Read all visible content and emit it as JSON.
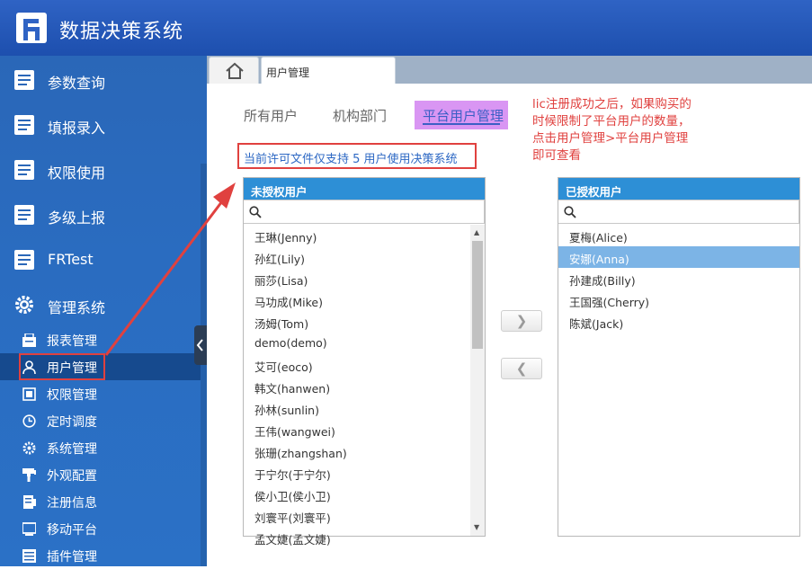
{
  "app": {
    "title": "数据决策系统"
  },
  "sidebar": {
    "main_items": [
      {
        "label": "参数查询",
        "icon": "report-icon"
      },
      {
        "label": "填报录入",
        "icon": "report-icon"
      },
      {
        "label": "权限使用",
        "icon": "report-icon"
      },
      {
        "label": "多级上报",
        "icon": "report-icon"
      },
      {
        "label": "FRTest",
        "icon": "report-icon"
      },
      {
        "label": "管理系统",
        "icon": "gear-icon"
      }
    ],
    "sub_items": [
      {
        "label": "报表管理",
        "icon": "report-manage-icon"
      },
      {
        "label": "用户管理",
        "icon": "user-icon",
        "active": true
      },
      {
        "label": "权限管理",
        "icon": "permission-icon"
      },
      {
        "label": "定时调度",
        "icon": "clock-icon"
      },
      {
        "label": "系统管理",
        "icon": "gear-icon"
      },
      {
        "label": "外观配置",
        "icon": "brush-icon"
      },
      {
        "label": "注册信息",
        "icon": "register-icon"
      },
      {
        "label": "移动平台",
        "icon": "mobile-icon"
      },
      {
        "label": "插件管理",
        "icon": "plugin-icon"
      }
    ]
  },
  "tabs": {
    "page_tab": "用户管理"
  },
  "subtabs": [
    "所有用户",
    "机构部门",
    "平台用户管理"
  ],
  "license_notice": "当前许可文件仅支持 5 用户使用决策系统",
  "annotation": [
    "lic注册成功之后，如果购买的",
    "时候限制了平台用户的数量，",
    "点击用户管理>平台用户管理",
    "即可查看"
  ],
  "unauthorized": {
    "title": "未授权用户",
    "search_placeholder": "",
    "users": [
      "王琳(Jenny)",
      "孙红(Lily)",
      "丽莎(Lisa)",
      "马功成(Mike)",
      "汤姆(Tom)",
      "demo(demo)",
      "艾可(eoco)",
      "韩文(hanwen)",
      "孙林(sunlin)",
      "王伟(wangwei)",
      "张珊(zhangshan)",
      "于宁尔(于宁尔)",
      "侯小卫(侯小卫)",
      "刘寰平(刘寰平)",
      "孟文婕(孟文婕)"
    ]
  },
  "authorized": {
    "title": "已授权用户",
    "search_placeholder": "",
    "users": [
      "夏梅(Alice)",
      "安娜(Anna)",
      "孙建成(Billy)",
      "王国强(Cherry)",
      "陈斌(Jack)"
    ],
    "selected_index": 1
  },
  "buttons": {
    "add": "❯",
    "remove": "❮"
  },
  "colors": {
    "header": "#2f63c4",
    "sidebar": "#2a6cc0",
    "panel_head": "#2d8fd6",
    "highlight": "#d996f3",
    "annotation": "#e0413f",
    "selected": "#7cb4e6"
  }
}
